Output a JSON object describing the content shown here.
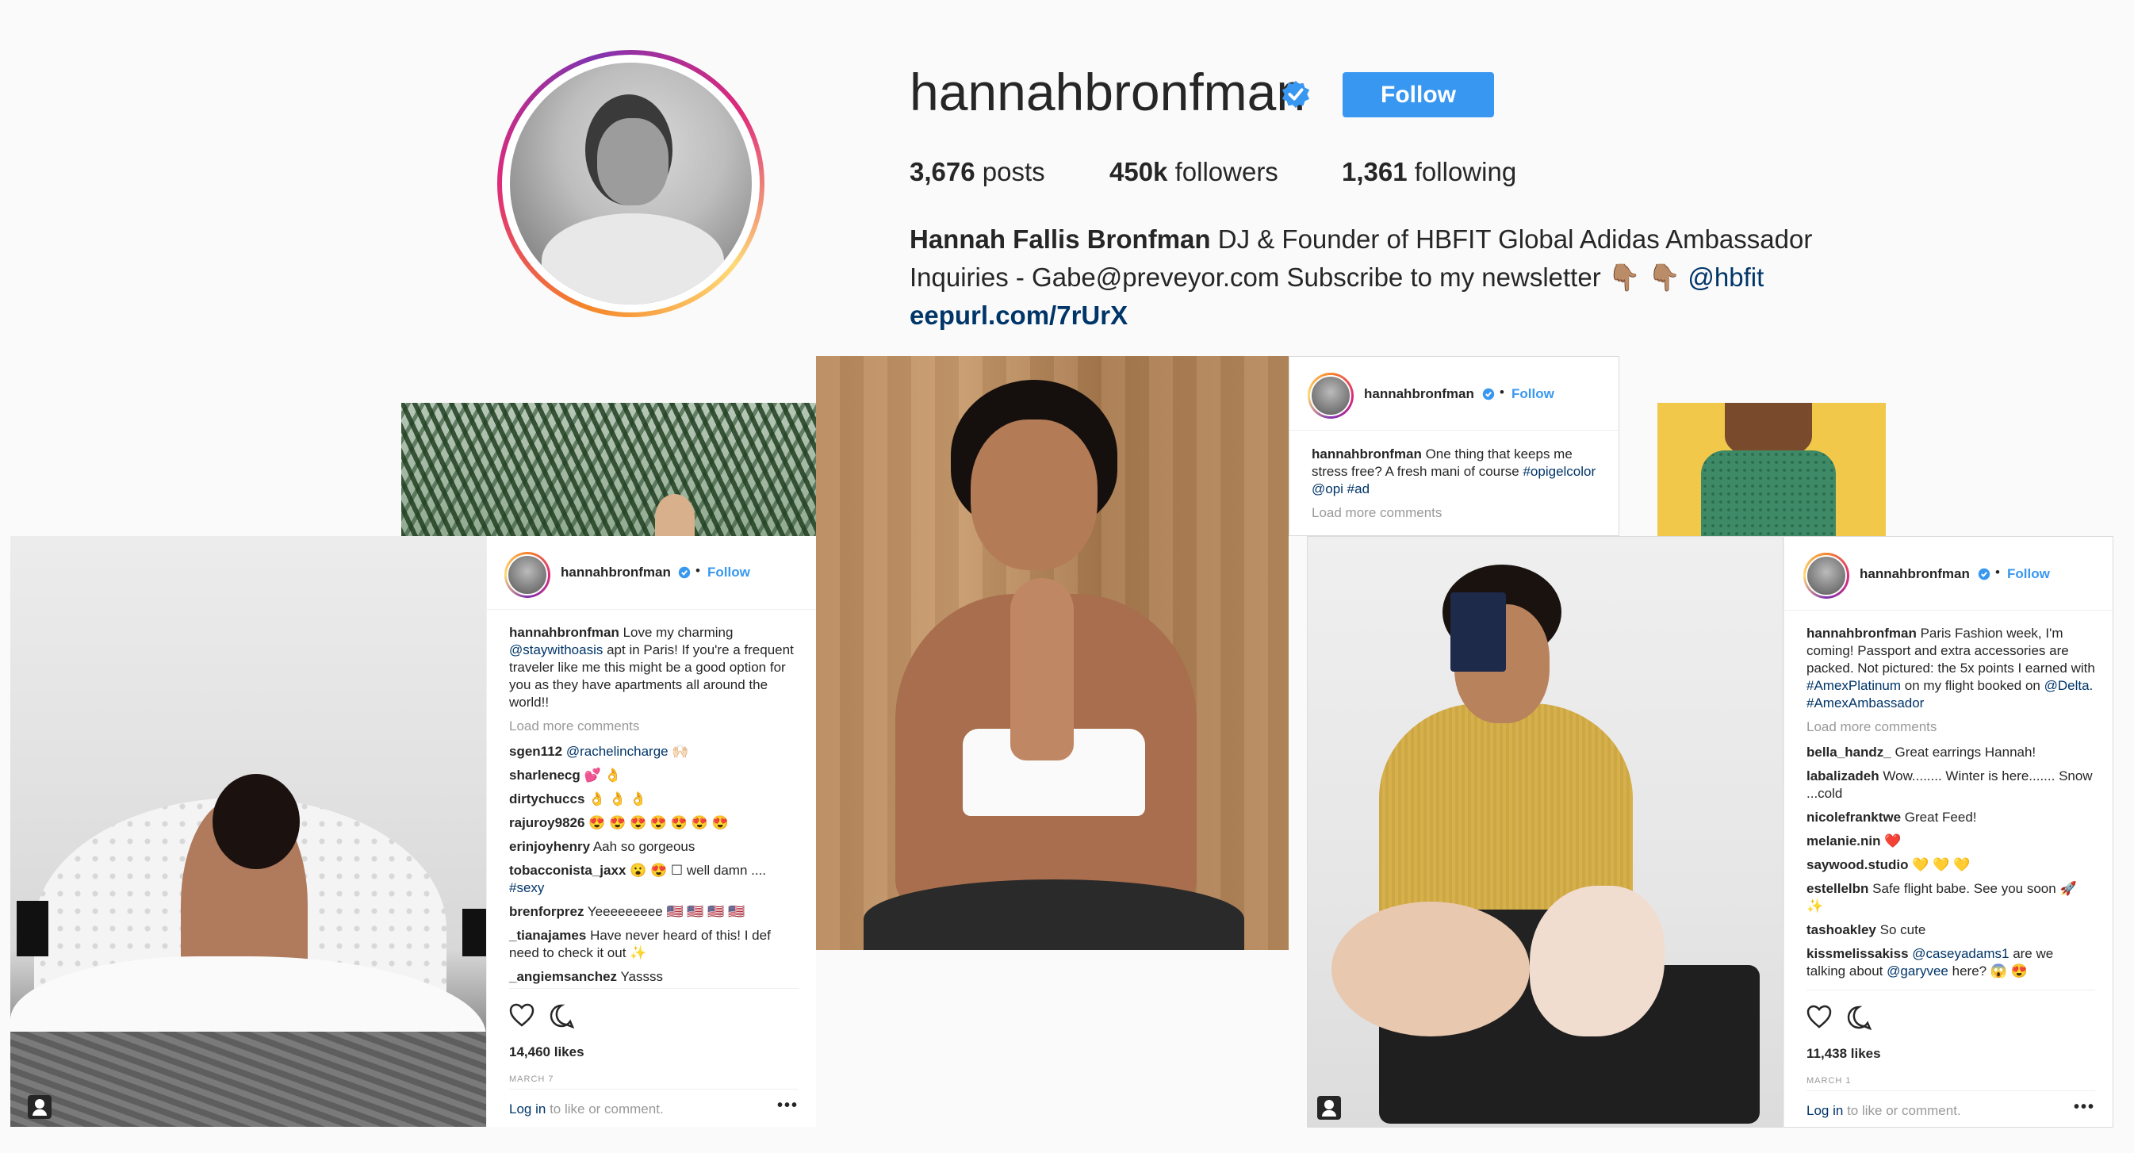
{
  "profile": {
    "username": "hannahbronfman",
    "follow_label": "Follow",
    "stats": {
      "posts_count": "3,676",
      "posts_label": "posts",
      "followers_count": "450k",
      "followers_label": "followers",
      "following_count": "1,361",
      "following_label": "following"
    },
    "bio": {
      "name": "Hannah Fallis Bronfman",
      "line1": "DJ & Founder of HBFIT Global Adidas Ambassador",
      "line2": "Inquiries - Gabe@preveyor.com Subscribe to my newsletter",
      "emoji": "👇🏽 👇🏽",
      "mention": "@hbfit",
      "link": "eepurl.com/7rUrX"
    }
  },
  "posts": [
    {
      "username": "hannahbronfman",
      "follow_label": "Follow",
      "caption_user": "hannahbronfman",
      "caption_pre": "Love my charming",
      "caption_mention": "@staywithoasis",
      "caption_post": "apt in Paris! If you're a frequent traveler like me this might be a good option for you as they have apartments all around the world!!",
      "load_more": "Load more comments",
      "comments": [
        {
          "user": "sgen112",
          "mention": "@rachelincharge",
          "text": "🙌🏻"
        },
        {
          "user": "sharlenecg",
          "text": "💕 👌"
        },
        {
          "user": "dirtychuccs",
          "text": "👌 👌 👌"
        },
        {
          "user": "rajuroy9826",
          "text": "😍 😍 😍 😍 😍 😍 😍"
        },
        {
          "user": "erinjoyhenry",
          "text": "Aah so gorgeous"
        },
        {
          "user": "tobacconista_jaxx",
          "text": "😮 😍 ☐ well damn ....",
          "tag": "#sexy"
        },
        {
          "user": "brenforprez",
          "text": "Yeeeeeeeee 🇺🇸 🇺🇸 🇺🇸 🇺🇸"
        },
        {
          "user": "_tianajames",
          "text": "Have never heard of this! I def need to check it out ✨"
        },
        {
          "user": "_angiemsanchez",
          "text": "Yassss"
        }
      ],
      "likes": "14,460 likes",
      "date": "MARCH 7",
      "login_link": "Log in",
      "login_text": "to like or comment.",
      "more": "•••"
    },
    {
      "username": "hannahbronfman",
      "follow_label": "Follow",
      "caption_user": "hannahbronfman",
      "caption_pre": "One thing that keeps me stress free? A fresh mani of course",
      "caption_tags": "#opigelcolor @opi #ad",
      "load_more": "Load more comments"
    },
    {
      "username": "hannahbronfman",
      "follow_label": "Follow",
      "caption_user": "hannahbronfman",
      "caption_pre": "Paris Fashion week, I'm coming! Passport and extra accessories are packed. Not pictured: the 5x points I earned with",
      "caption_tag1": "#AmexPlatinum",
      "caption_mid": "on my flight booked on",
      "caption_mention": "@Delta.",
      "caption_tag2": "#AmexAmbassador",
      "load_more": "Load more comments",
      "comments": [
        {
          "user": "bella_handz_",
          "text": "Great earrings Hannah!"
        },
        {
          "user": "labalizadeh",
          "text": "Wow........ Winter is here....... Snow ...cold"
        },
        {
          "user": "nicolefranktwe",
          "text": "Great Feed!"
        },
        {
          "user": "melanie.nin",
          "text": "❤️"
        },
        {
          "user": "saywood.studio",
          "text": "💛 💛 💛"
        },
        {
          "user": "estellelbn",
          "text": "Safe flight babe. See you soon 🚀 ✨"
        },
        {
          "user": "tashoakley",
          "text": "So cute"
        },
        {
          "user": "kissmelissakiss",
          "mention": "@caseyadams1",
          "text": "are we talking about",
          "mention2": "@garyvee",
          "text2": "here? 😱 😍"
        }
      ],
      "likes": "11,438 likes",
      "date": "MARCH 1",
      "login_link": "Log in",
      "login_text": "to like or comment.",
      "more": "•••"
    }
  ],
  "colors": {
    "accent": "#3897f0",
    "link": "#003569",
    "text": "#262626",
    "muted": "#999999",
    "background": "#fafafa"
  },
  "icons": {
    "verified": "verified-badge-icon",
    "heart": "heart-icon",
    "comment": "comment-icon",
    "tagged_user": "tagged-user-icon",
    "more": "more-options-icon"
  }
}
